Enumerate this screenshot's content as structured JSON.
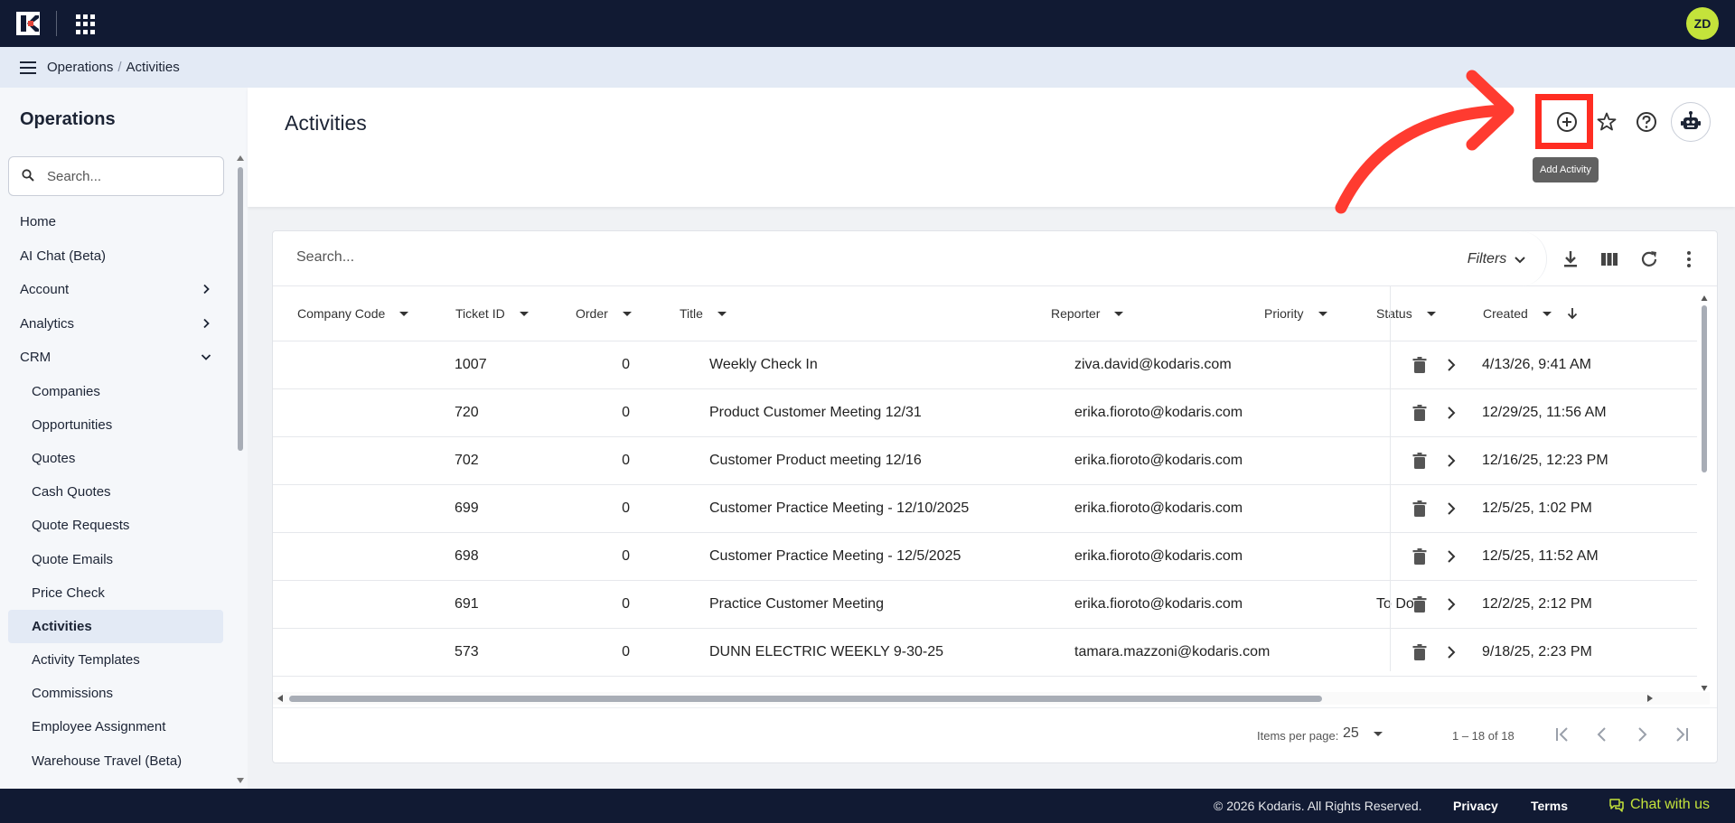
{
  "topbar": {
    "avatar_initials": "ZD",
    "brand_color": "#111a33",
    "avatar_color": "#c4e33b"
  },
  "breadcrumb": {
    "section": "Operations",
    "separator": "/",
    "page": "Activities"
  },
  "sidebar": {
    "title": "Operations",
    "search_placeholder": "Search...",
    "items": [
      {
        "label": "Home"
      },
      {
        "label": "AI Chat (Beta)"
      },
      {
        "label": "Account",
        "icon": "chevron-right-icon"
      },
      {
        "label": "Analytics",
        "icon": "chevron-right-icon"
      },
      {
        "label": "CRM",
        "icon": "chevron-down-icon"
      }
    ],
    "sub_items": [
      {
        "label": "Companies"
      },
      {
        "label": "Opportunities"
      },
      {
        "label": "Quotes"
      },
      {
        "label": "Cash Quotes"
      },
      {
        "label": "Quote Requests"
      },
      {
        "label": "Quote Emails"
      },
      {
        "label": "Price Check"
      },
      {
        "label": "Activities",
        "active": true
      },
      {
        "label": "Activity Templates"
      },
      {
        "label": "Commissions"
      },
      {
        "label": "Employee Assignment"
      },
      {
        "label": "Warehouse Travel (Beta)"
      }
    ]
  },
  "main": {
    "title": "Activities",
    "tooltip": "Add Activity",
    "highlight_color": "#ff2d22"
  },
  "table": {
    "search_placeholder": "Search...",
    "filters_label": "Filters",
    "columns": [
      "Company Code",
      "Ticket ID",
      "Order",
      "Title",
      "Reporter",
      "Priority",
      "Status",
      "Created"
    ],
    "rows": [
      {
        "company": "",
        "ticket": "1007",
        "order": "0",
        "title": "Weekly Check In",
        "reporter": "ziva.david@kodaris.com",
        "priority": "",
        "status": "",
        "created": "4/13/26, 9:41 AM"
      },
      {
        "company": "",
        "ticket": "720",
        "order": "0",
        "title": "Product Customer Meeting 12/31",
        "reporter": "erika.fioroto@kodaris.com",
        "priority": "",
        "status": "",
        "created": "12/29/25, 11:56 AM"
      },
      {
        "company": "",
        "ticket": "702",
        "order": "0",
        "title": "Customer Product meeting 12/16",
        "reporter": "erika.fioroto@kodaris.com",
        "priority": "",
        "status": "",
        "created": "12/16/25, 12:23 PM"
      },
      {
        "company": "",
        "ticket": "699",
        "order": "0",
        "title": "Customer Practice Meeting - 12/10/2025",
        "reporter": "erika.fioroto@kodaris.com",
        "priority": "",
        "status": "",
        "created": "12/5/25, 1:02 PM"
      },
      {
        "company": "",
        "ticket": "698",
        "order": "0",
        "title": "Customer Practice Meeting - 12/5/2025",
        "reporter": "erika.fioroto@kodaris.com",
        "priority": "",
        "status": "",
        "created": "12/5/25, 11:52 AM"
      },
      {
        "company": "",
        "ticket": "691",
        "order": "0",
        "title": "Practice Customer Meeting",
        "reporter": "erika.fioroto@kodaris.com",
        "priority": "",
        "status": "To Do",
        "created": "12/2/25, 2:12 PM"
      },
      {
        "company": "",
        "ticket": "573",
        "order": "0",
        "title": "DUNN ELECTRIC WEEKLY 9-30-25",
        "reporter": "tamara.mazzoni@kodaris.com",
        "priority": "",
        "status": "",
        "created": "9/18/25, 2:23 PM"
      }
    ]
  },
  "paginator": {
    "items_per_page_label": "Items per page:",
    "page_size": "25",
    "range": "1 – 18 of 18"
  },
  "footer": {
    "copyright": "© 2026 Kodaris. All Rights Reserved.",
    "privacy": "Privacy",
    "terms": "Terms",
    "chat": "Chat with us"
  }
}
